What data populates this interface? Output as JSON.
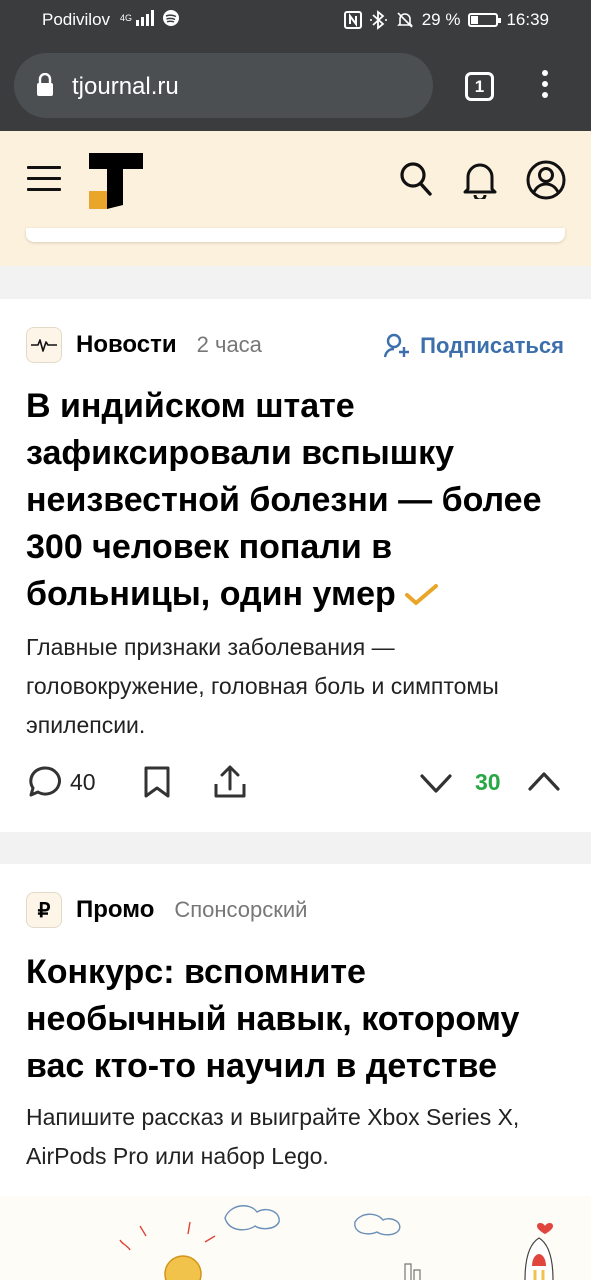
{
  "status_bar": {
    "carrier": "Podivilov",
    "network": "4G",
    "battery_text": "29 %",
    "battery_level": 0.29,
    "time": "16:39"
  },
  "browser": {
    "url": "tjournal.ru",
    "tab_count": "1"
  },
  "colors": {
    "header_bg": "#fcf1dc",
    "accent_yellow": "#e9a62a",
    "link_blue": "#3c6fab",
    "vote_green": "#28a745"
  },
  "icons": [
    "lock-icon",
    "menu-dots-icon",
    "hamburger-icon",
    "tjournal-logo",
    "search-icon",
    "bell-icon",
    "profile-icon",
    "news-pulse-icon",
    "add-user-icon",
    "verified-check-icon",
    "comment-icon",
    "bookmark-icon",
    "share-icon",
    "vote-down-icon",
    "vote-up-icon",
    "ruble-icon"
  ],
  "post1": {
    "category": "Новости",
    "time": "2 часа",
    "subscribe_label": "Подписаться",
    "title": "В индийском штате зафиксировали вспышку неизвестной болезни — более 300 человек попали в больницы, один умер",
    "lead": "Главные признаки заболевания — головокружение, головная боль и симптомы эпилепсии.",
    "comments": "40",
    "rating": "30"
  },
  "post2": {
    "category": "Промо",
    "label": "Спонсорский",
    "title": "Конкурс: вспомните необычный навык, которому вас кто-то научил в детстве",
    "lead": "Напишите рассказ и выиграйте Xbox Series X, AirPods Pro или набор Lego."
  }
}
